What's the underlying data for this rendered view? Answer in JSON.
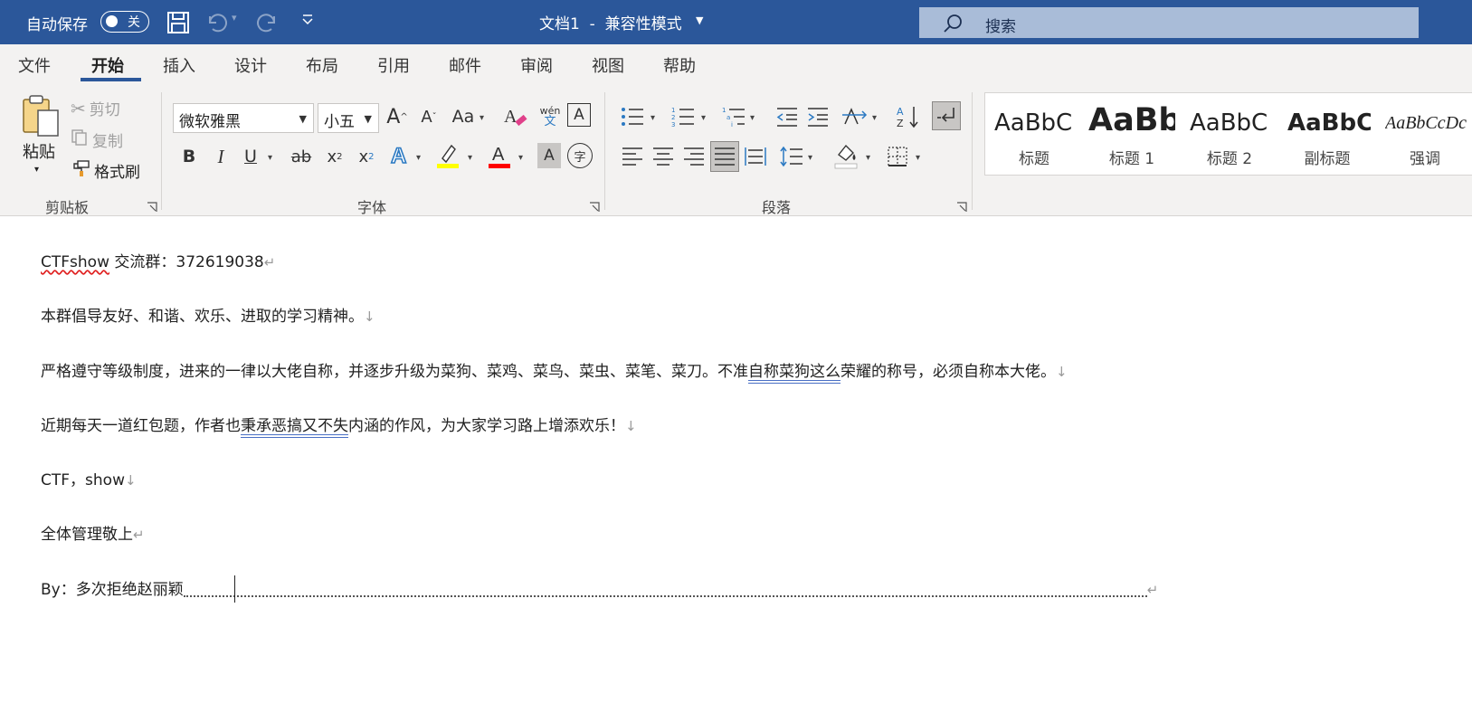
{
  "titlebar": {
    "autosave_label": "自动保存",
    "autosave_state": "关",
    "doc_title": "文档1  -  兼容性模式",
    "search_placeholder": "搜索"
  },
  "tabs": [
    "文件",
    "开始",
    "插入",
    "设计",
    "布局",
    "引用",
    "邮件",
    "审阅",
    "视图",
    "帮助"
  ],
  "active_tab": "开始",
  "clipboard": {
    "paste": "粘贴",
    "cut": "剪切",
    "copy": "复制",
    "format_painter": "格式刷",
    "group_label": "剪贴板"
  },
  "font": {
    "font_name": "微软雅黑",
    "font_size": "小五",
    "change_case": "Aa",
    "phonetic_top": "wén",
    "phonetic_bottom": "文",
    "bold": "B",
    "italic": "I",
    "underline": "U",
    "strike": "ab",
    "subscript": "x",
    "superscript": "x",
    "enclose": "字",
    "group_label": "字体",
    "highlight_color": "#ffff00",
    "font_color": "#ff0000"
  },
  "paragraph": {
    "group_label": "段落"
  },
  "styles": [
    {
      "preview": "AaBbC",
      "name": "标题"
    },
    {
      "preview": "AaBb",
      "name": "标题 1"
    },
    {
      "preview": "AaBbC",
      "name": "标题 2"
    },
    {
      "preview": "AaBbC",
      "name": "副标题"
    },
    {
      "preview": "AaBbCcDc",
      "name": "强调"
    }
  ],
  "document": {
    "line1_a": "CTFshow",
    "line1_b": " 交流群：372619038",
    "line2": "本群倡导友好、和谐、欢乐、进取的学习精神。",
    "line3_a": "严格遵守等级制度，进来的一律以大佬自称，并逐步升级为菜狗、菜鸡、菜鸟、菜虫、菜笔、菜刀。不准",
    "line3_b": "自称菜狗这么",
    "line3_c": "荣耀的称号，必须自称本大佬。",
    "line4_a": "近期每天一道红包题，作者也",
    "line4_b": "秉承恶搞又不失",
    "line4_c": "内涵的作风，为大家学习路上增添欢乐！",
    "line5": "CTF，show",
    "line6": "全体管理敬上",
    "line7": "By：多次拒绝赵丽颖",
    "para_mark": "↵",
    "line_break_mark": "↓"
  },
  "colors": {
    "titlebar": "#2b579a",
    "ribbon": "#f3f2f1",
    "accent": "#2b579a"
  }
}
